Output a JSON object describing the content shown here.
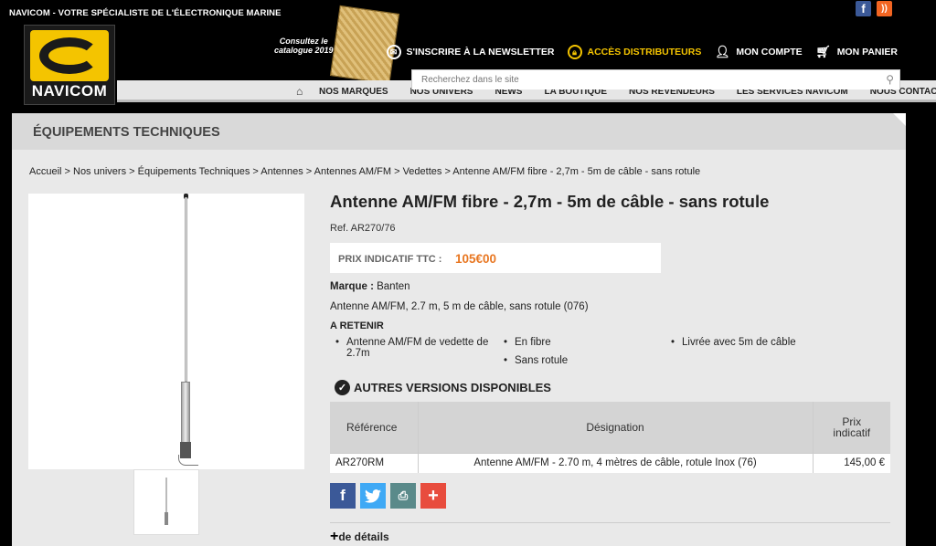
{
  "header": {
    "tagline": "NAVICOM - VOTRE SPÉCIALISTE DE L'ÉLECTRONIQUE MARINE",
    "logo_text": "NAVICOM",
    "catalog_text_1": "Consultez le",
    "catalog_text_2": "catalogue 2019",
    "social": {
      "facebook": "f",
      "rss": "))"
    },
    "links": {
      "newsletter": "S'INSCRIRE À LA NEWSLETTER",
      "distributors": "ACCÈS DISTRIBUTEURS",
      "account": "MON COMPTE",
      "cart": "MON PANIER"
    },
    "search_placeholder": "Recherchez dans le site"
  },
  "nav": {
    "items": [
      "NOS MARQUES",
      "NOS UNIVERS",
      "NEWS",
      "LA BOUTIQUE",
      "NOS REVENDEURS",
      "LES SERVICES NAVICOM",
      "NOUS CONTACTER"
    ]
  },
  "section_title": "ÉQUIPEMENTS TECHNIQUES",
  "breadcrumb": "Accueil > Nos univers > Équipements Techniques > Antennes > Antennes AM/FM > Vedettes > Antenne AM/FM fibre - 2,7m - 5m de câble - sans rotule",
  "product": {
    "title": "Antenne AM/FM fibre - 2,7m - 5m de câble - sans rotule",
    "ref": "Ref. AR270/76",
    "price_label": "PRIX INDICATIF TTC :",
    "price": "105€00",
    "brand_label": "Marque :",
    "brand": " Banten",
    "description": "Antenne AM/FM, 2.7 m, 5 m de câble, sans rotule (076)",
    "retenir_title": "A RETENIR",
    "bullets": [
      "Antenne AM/FM de vedette de 2.7m",
      "En fibre",
      "Sans rotule",
      "Livrée avec 5m de câble"
    ]
  },
  "versions": {
    "title": "AUTRES VERSIONS DISPONIBLES",
    "headers": {
      "ref": "Référence",
      "designation": "Désignation",
      "price_1": "Prix",
      "price_2": "indicatif"
    },
    "rows": [
      {
        "ref": "AR270RM",
        "designation": "Antenne AM/FM - 2.70 m, 4 mètres de câble, rotule Inox (76)",
        "price": "145,00 €"
      }
    ]
  },
  "share": {
    "facebook": "f",
    "twitter": "t",
    "print": "⎙",
    "more": "+"
  },
  "details_label": "de détails",
  "colors": {
    "accent": "#f4c400",
    "price": "#e87722"
  }
}
